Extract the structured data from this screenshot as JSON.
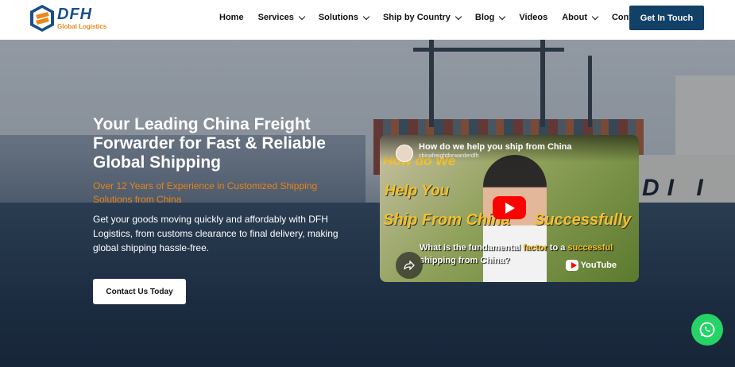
{
  "brand": {
    "name": "DFH",
    "tagline": "Global Logistics",
    "primary_color": "#124168",
    "accent_color": "#e8891b"
  },
  "nav": {
    "items": [
      {
        "label": "Home",
        "dropdown": false
      },
      {
        "label": "Services",
        "dropdown": true
      },
      {
        "label": "Solutions",
        "dropdown": true
      },
      {
        "label": "Ship by Country",
        "dropdown": true
      },
      {
        "label": "Blog",
        "dropdown": true
      },
      {
        "label": "Videos",
        "dropdown": false
      },
      {
        "label": "About",
        "dropdown": true
      },
      {
        "label": "Contact us",
        "dropdown": false
      }
    ],
    "cta_label": "Get In Touch"
  },
  "hero": {
    "title": "Your Leading China Freight Forwarder for Fast & Reliable Global Shipping",
    "subtitle": "Over 12 Years of Experience in Customized Shipping Solutions from China",
    "description": "Get your goods moving quickly and affordably with DFH Logistics, from customs clearance to final delivery, making global shipping hassle-free.",
    "cta_label": "Contact Us Today",
    "ship_text": "DI I"
  },
  "video": {
    "title": "How do we help you ship from China",
    "channel": "chinafreightforwarderdfh",
    "overlay_1": "How do We",
    "overlay_2": "Help You",
    "overlay_3": "Ship From China",
    "overlay_4": "Successfully",
    "caption_pre": "What is the fundamental ",
    "caption_hl1": "factor",
    "caption_mid": " to a ",
    "caption_hl2": "successful",
    "caption_post": " shipping from China?",
    "platform_label": "YouTube",
    "icons": [
      "play-icon",
      "share-icon",
      "youtube-icon"
    ]
  },
  "floating": {
    "whatsapp_icon": "whatsapp-icon",
    "whatsapp_color": "#25d366"
  }
}
